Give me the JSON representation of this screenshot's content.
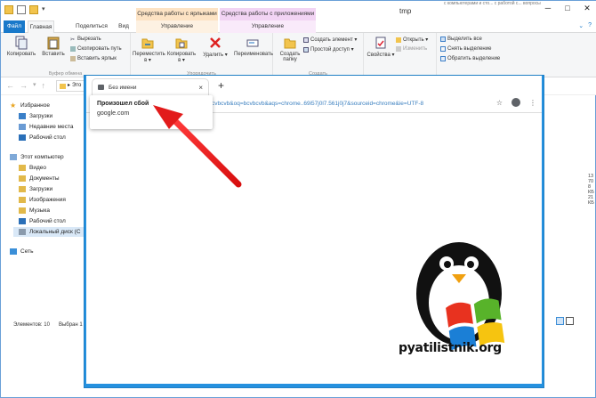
{
  "explorer": {
    "window_title": "tmp",
    "title_truncated": "с компьютерами и сто...   с работой с...   вопросы",
    "context_tabs": {
      "shortcuts": "Средства работы с ярлыками",
      "apps": "Средства работы с приложениями"
    },
    "ribbon_tabs": {
      "file": "Файл",
      "home": "Главная",
      "share": "Поделиться",
      "view": "Вид",
      "manage1": "Управление",
      "manage2": "Управление"
    },
    "ribbon": {
      "copy": "Копировать",
      "paste": "Вставить",
      "cut": "Вырезать",
      "copy_path": "Скопировать путь",
      "paste_shortcut": "Вставить ярлык",
      "clipboard_group": "Буфер обмена",
      "move_to": "Переместить в ▾",
      "copy_to": "Копировать в ▾",
      "delete": "Удалить ▾",
      "rename": "Переименовать",
      "organize_group": "Упорядочить",
      "new_folder": "Создать папку",
      "new_item": "Создать элемент ▾",
      "easy_access": "Простой доступ ▾",
      "create_group": "Создать",
      "properties": "Свойства ▾",
      "open": "Открыть ▾",
      "edit": "Изменить",
      "select_all": "Выделить все",
      "select_none": "Снять выделение",
      "invert_selection": "Обратить выделение"
    },
    "address": {
      "path_fragment": "Это"
    },
    "nav": {
      "favorites": "Избранное",
      "downloads": "Загрузки",
      "recent": "Недавние места",
      "desktop": "Рабочий стол",
      "this_pc": "Этот компьютер",
      "video": "Видео",
      "documents": "Документы",
      "downloads2": "Загрузки",
      "images": "Изображения",
      "music": "Музыка",
      "desktop2": "Рабочий стол",
      "local_disk": "Локальный диск (С",
      "network": "Сеть"
    },
    "status": {
      "items": "Элементов: 10",
      "selected": "Выбран 1"
    },
    "right_values": [
      "13 70",
      "8 КБ",
      "21 КБ"
    ]
  },
  "chrome": {
    "tab_title": "Без имени",
    "new_tab": "+",
    "close_tab": "×",
    "omnibox_fragment": "q=bcvbcvb&oq=bcvbcvb&aqs=chrome..69i57j0l7.561j0j7&sourceid=chrome&ie=UTF-8",
    "dropdown_title": "Произошел сбой",
    "dropdown_subtitle": "google.com"
  },
  "watermark": {
    "text": "pyatilistnik.org"
  }
}
